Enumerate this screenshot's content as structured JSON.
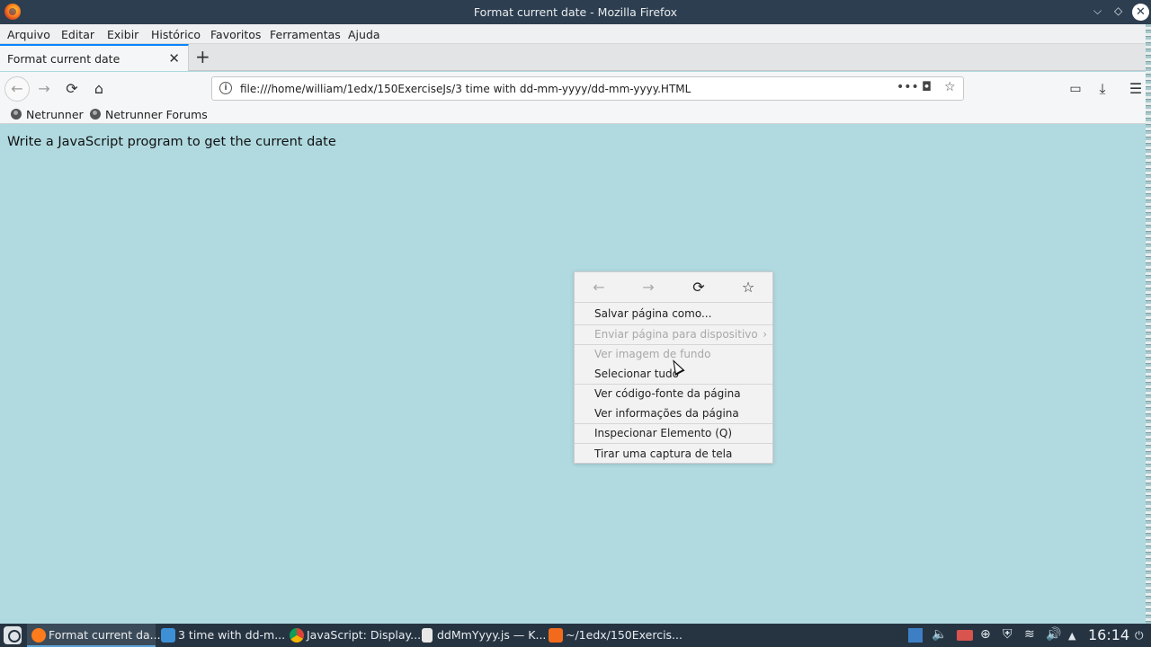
{
  "window": {
    "title": "Format current date - Mozilla Firefox",
    "controls": [
      "⌵",
      "◇",
      "✕"
    ]
  },
  "menubar": [
    "Arquivo",
    "Editar",
    "Exibir",
    "Histórico",
    "Favoritos",
    "Ferramentas",
    "Ajuda"
  ],
  "tab": {
    "title": "Format current date",
    "close": "✕",
    "new": "+"
  },
  "navbar": {
    "url": "file:///home/william/1edx/150ExerciseJs/3 time with dd-mm-yyyy/dd-mm-yyyy.HTML",
    "icons": [
      "arrow-left-icon",
      "arrow-right-icon",
      "reload-icon",
      "home-icon",
      "info-icon",
      "more-icon",
      "pocket-icon",
      "star-icon",
      "library-icon",
      "download-icon",
      "menu-icon"
    ]
  },
  "bookmarks": [
    {
      "label": "Netrunner"
    },
    {
      "label": "Netrunner Forums"
    }
  ],
  "page": {
    "heading": "Write a JavaScript program to get the current date"
  },
  "context_menu": {
    "nav_icons": [
      "back-icon",
      "forward-icon",
      "reload-icon",
      "bookmark-star-icon"
    ],
    "items": [
      {
        "label": "Salvar página como...",
        "enabled": true
      },
      {
        "label": "Enviar página para dispositivo",
        "enabled": false,
        "submenu": true
      },
      {
        "label": "Ver imagem de fundo",
        "enabled": false
      },
      {
        "label": "Selecionar tudo",
        "enabled": true
      },
      {
        "label": "Ver código-fonte da página",
        "enabled": true
      },
      {
        "label": "Ver informações da página",
        "enabled": true
      },
      {
        "label": "Inspecionar Elemento (Q)",
        "enabled": true
      },
      {
        "label": "Tirar uma captura de tela",
        "enabled": true
      }
    ]
  },
  "taskbar": {
    "tasks": [
      {
        "label": "Format current da...",
        "active": true,
        "icon": "firefox-icon",
        "color": "#ff7b1c"
      },
      {
        "label": "3 time with dd-m...",
        "active": false,
        "icon": "folder-icon",
        "color": "#3d8fd6"
      },
      {
        "label": "JavaScript: Display...",
        "active": false,
        "icon": "chrome-icon",
        "color": "#e0b02c"
      },
      {
        "label": "ddMmYyyy.js — K...",
        "active": false,
        "icon": "text-file-icon",
        "color": "#e8e8e8"
      },
      {
        "label": "~/1edx/150Exercis...",
        "active": false,
        "icon": "sublime-icon",
        "color": "#f26b1d"
      }
    ],
    "clock": "16:14"
  },
  "colors": {
    "page_background": "#b0dae0",
    "titlebar": "#2d3e50",
    "taskbar": "#263442",
    "tab_accent": "#0a84ff"
  }
}
